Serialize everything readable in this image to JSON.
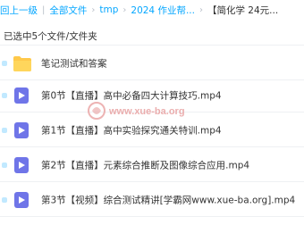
{
  "breadcrumb": {
    "back": "回上一级",
    "all_files": "全部文件",
    "tmp": "tmp",
    "folder_2024": "2024 作业帮...",
    "current": "【简化学 24元..."
  },
  "selection": {
    "info": "已选中5个文件/文件夹"
  },
  "files": [
    {
      "name": "笔记测试和答案",
      "type": "folder-icon"
    },
    {
      "name": "第0节【直播】高中必备四大计算技巧.mp4",
      "type": "video-icon"
    },
    {
      "name": "第1节【直播】高中实验探究通关特训.mp4",
      "type": "video-icon"
    },
    {
      "name": "第2节【直播】元素综合推断及图像综合应用.mp4",
      "type": "video-icon"
    },
    {
      "name": "第3节【视频】综合测试精讲[学霸网www.xue-ba.org].mp4",
      "type": "video-icon"
    }
  ],
  "watermark": {
    "text": "www.xue-ba.org"
  },
  "colors": {
    "link": "#06a7ff",
    "folder": "#ffc94a",
    "video": "#6f75e8",
    "watermark": "#e8a0a0"
  }
}
